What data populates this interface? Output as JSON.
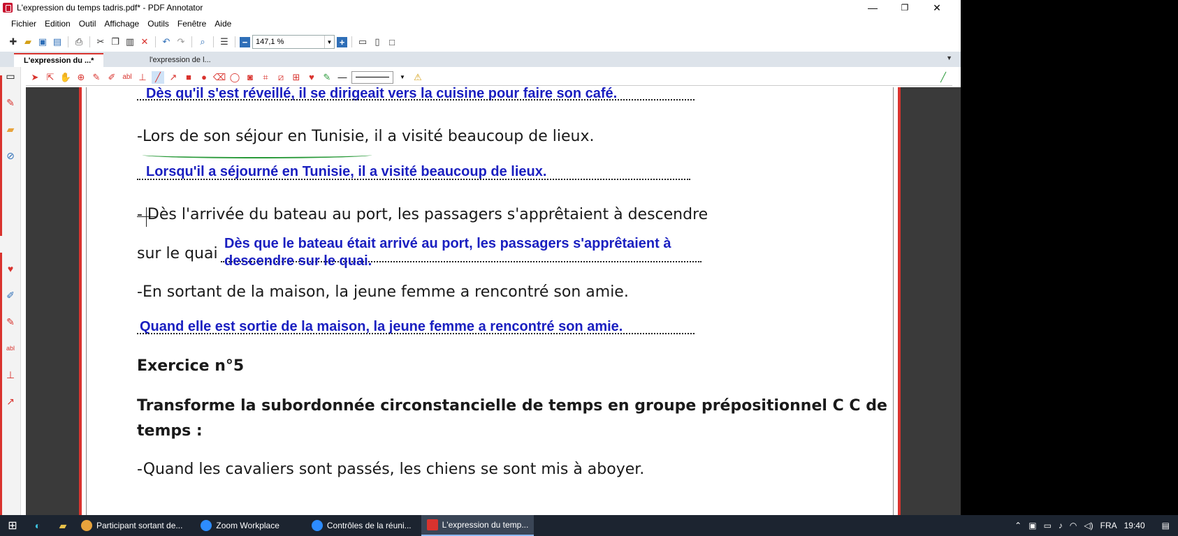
{
  "window": {
    "title": "L'expression du temps tadris.pdf* - PDF Annotator",
    "minimize": "—",
    "maximize": "❐",
    "close": "✕"
  },
  "menu": [
    "Fichier",
    "Edition",
    "Outil",
    "Affichage",
    "Outils",
    "Fenêtre",
    "Aide"
  ],
  "toolbar": {
    "zoom_value": "147,1 %"
  },
  "tabs": [
    {
      "label": "L'expression du ...*",
      "active": true
    },
    {
      "label": "l'expression de l...",
      "active": false
    }
  ],
  "document": {
    "ans1": "Dès qu'il s'est réveillé, il se dirigeait vers la cuisine pour faire son café.",
    "q2": "-Lors de son séjour en Tunisie, il a visité beaucoup de lieux.",
    "ans2": "Lorsqu'il a  séjourné en Tunisie, il a visité beaucoup de lieux.",
    "q3a": "- Dès l'arrivée du bateau au port, les passagers s'apprêtaient à descendre",
    "q3b": "sur le quai",
    "ans3a": "Dès que le bateau était arrivé au port, les passagers s'apprêtaient à",
    "ans3b": "descendre sur le quai.",
    "q4": "-En sortant de la maison, la jeune femme a rencontré son amie.",
    "ans4": "Quand elle est sortie de la maison, la jeune femme a rencontré son amie.",
    "exercise_title": "Exercice n°5",
    "instruction_a": "Transforme la subordonnée circonstancielle de temps en groupe prépositionnel C C de",
    "instruction_b": "temps :",
    "q5": "-Quand les cavaliers sont passés, les chiens se sont mis à aboyer."
  },
  "taskbar": {
    "apps": [
      {
        "label": "Participant sortant de...",
        "icon_color": "#e8a33c"
      },
      {
        "label": "Zoom Workplace",
        "icon_color": "#2d8cff"
      },
      {
        "label": "Contrôles de la réuni...",
        "icon_color": "#2d8cff"
      },
      {
        "label": "L'expression du temp...",
        "icon_color": "#d9332e"
      }
    ],
    "language": "FRA",
    "time": "19:40"
  },
  "colors": {
    "accent_red": "#d9332e",
    "annotation_blue": "#1a1fc0",
    "underline_green": "#2a9a3a"
  }
}
